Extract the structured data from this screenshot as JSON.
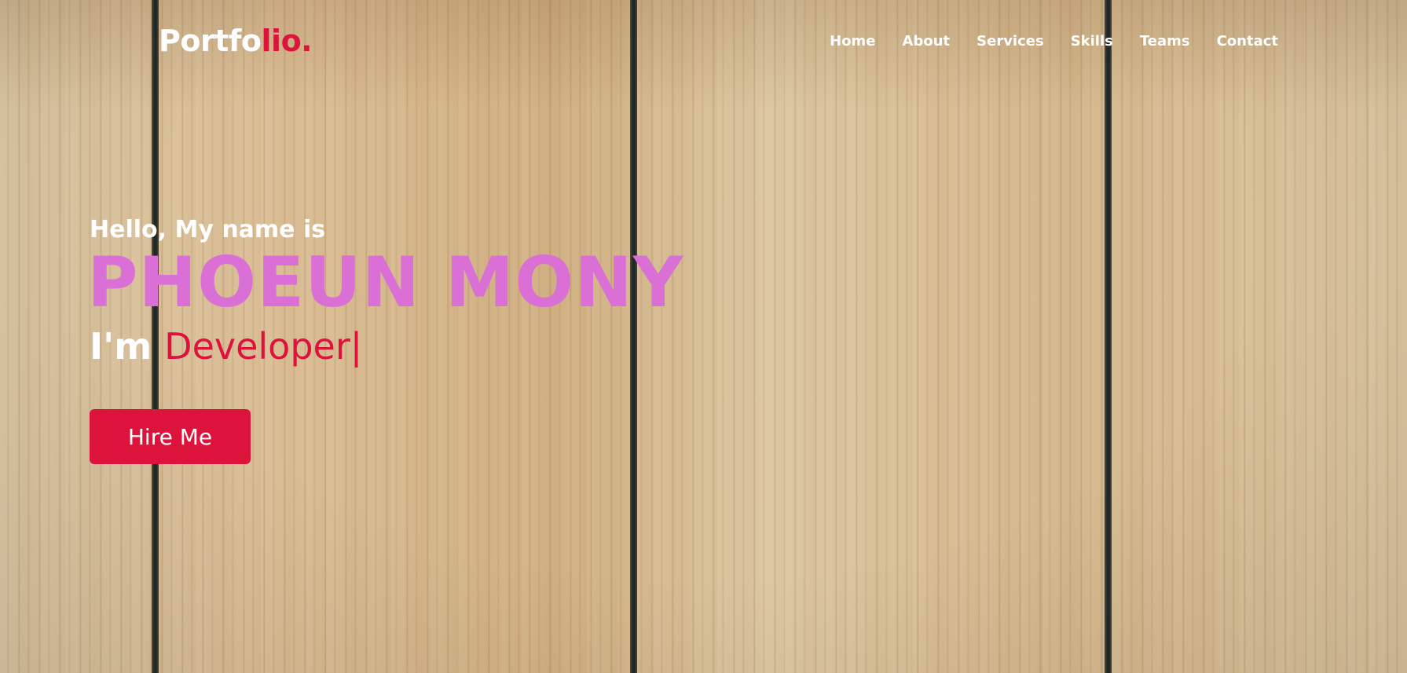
{
  "header": {
    "logo": {
      "main": "Portfo",
      "accent": "lio."
    },
    "nav": [
      {
        "label": "Home"
      },
      {
        "label": "About"
      },
      {
        "label": "Services"
      },
      {
        "label": "Skills"
      },
      {
        "label": "Teams"
      },
      {
        "label": "Contact"
      }
    ]
  },
  "hero": {
    "greeting": "Hello, My name is",
    "name": "PHOEUN MONY",
    "role_prefix": "I'm ",
    "role_typed": "Developer",
    "cursor": "|",
    "cta_label": "Hire Me"
  },
  "colors": {
    "accent": "#dc143c",
    "name": "#da70d6",
    "text": "#ffffff",
    "background_wood": "#d9bf95"
  }
}
